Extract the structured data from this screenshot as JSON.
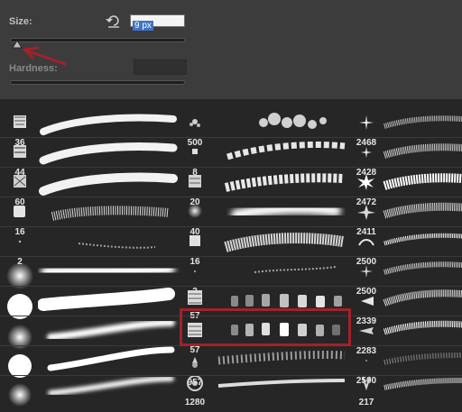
{
  "panel": {
    "size_label": "Size:",
    "size_value": "9 px",
    "hardness_label": "Hardness:",
    "size_slider_fraction": 0.04
  },
  "colors": {
    "panel_bg": "#3c3c3c",
    "grid_bg": "#262626",
    "text_selected_bg": "#3f73c4",
    "annotation_red": "#a3212b"
  },
  "icons": {
    "reset": "reset-arrow-icon",
    "annotation": "red-arrow-annotation"
  },
  "brushes": {
    "col1": [
      "36",
      "44",
      "60",
      "16",
      "2",
      "",
      "",
      "",
      "",
      ""
    ],
    "col2": [
      "500",
      "8",
      "20",
      "40",
      "16",
      "2",
      "57",
      "57",
      "957",
      "1280"
    ],
    "col3": [
      "2468",
      "2428",
      "2472",
      "2411",
      "2500",
      "2500",
      "2339",
      "2283",
      "2500",
      "217"
    ]
  },
  "selected_brush": "57"
}
